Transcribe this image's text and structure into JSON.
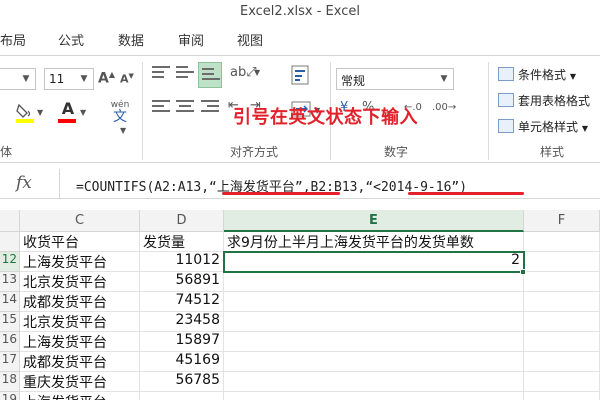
{
  "window": {
    "title": "Excel2.xlsx - Excel"
  },
  "ribbon_tabs": [
    "布局",
    "公式",
    "数据",
    "审阅",
    "视图"
  ],
  "ribbon": {
    "font_size": "11",
    "number_format": "常规",
    "wen_label": "wén",
    "wen_char": "文",
    "groups": {
      "font_tail": "体",
      "alignment": "对齐方式",
      "number": "数字",
      "styles": "样式"
    },
    "style_items": [
      "条件格式",
      "套用表格格式",
      "单元格样式"
    ],
    "number_buttons": {
      "percent": "%",
      "comma": ",",
      "currency": "¥"
    },
    "colors": {
      "highlight": "#ffff00",
      "font_color": "#ff0000",
      "accent": "#217346"
    }
  },
  "annotation": "引号在英文状态下输入",
  "formula_bar": {
    "fx": "fx",
    "formula": "=COUNTIFS(A2:A13,“上海发货平台”,B2:B13,“<2014-9-16”)"
  },
  "grid": {
    "columns": [
      "C",
      "D",
      "E",
      "F"
    ],
    "selected_column": "E",
    "rows": [
      {
        "num": "",
        "c": "收货平台",
        "d": "发货量",
        "e": "求9月份上半月上海发货平台的发货单数"
      },
      {
        "num": "12",
        "c": "上海发货平台",
        "d": "11012",
        "e": "2"
      },
      {
        "num": "13",
        "c": "北京发货平台",
        "d": "56891",
        "e": ""
      },
      {
        "num": "14",
        "c": "成都发货平台",
        "d": "74512",
        "e": ""
      },
      {
        "num": "15",
        "c": "北京发货平台",
        "d": "23458",
        "e": ""
      },
      {
        "num": "16",
        "c": "上海发货平台",
        "d": "15897",
        "e": ""
      },
      {
        "num": "17",
        "c": "成都发货平台",
        "d": "45169",
        "e": ""
      },
      {
        "num": "18",
        "c": "重庆发货平台",
        "d": "56785",
        "e": ""
      },
      {
        "num": "19",
        "c": "上海发货平台",
        "d": "",
        "e": ""
      }
    ]
  }
}
